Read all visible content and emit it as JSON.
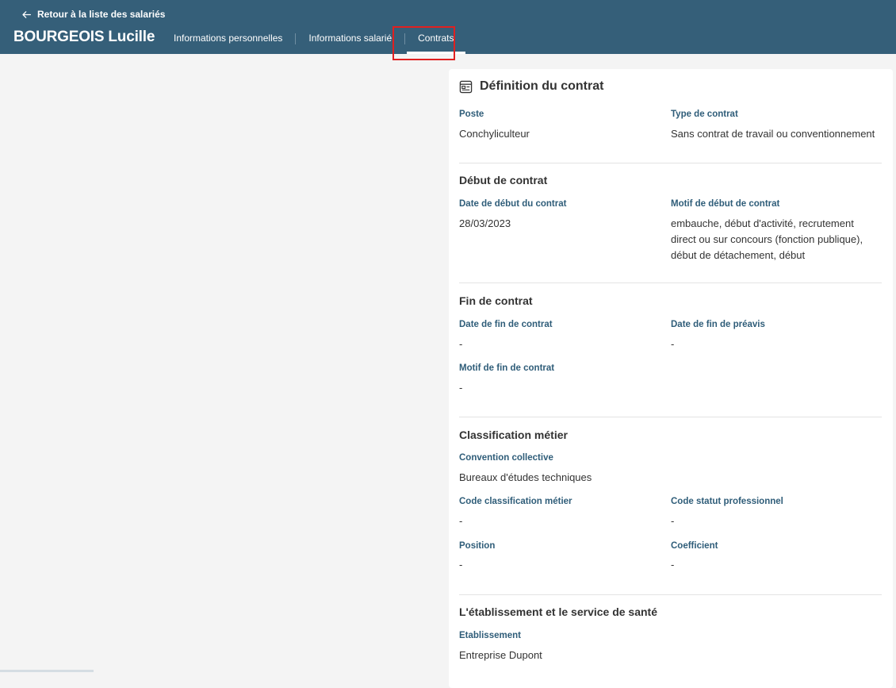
{
  "header": {
    "back_label": "Retour à la liste des salariés",
    "employee_name": "BOURGEOIS Lucille",
    "tabs": [
      {
        "label": "Informations personnelles"
      },
      {
        "label": "Informations salarié"
      },
      {
        "label": "Contrats"
      }
    ],
    "active_tab": "Contrats"
  },
  "colors": {
    "header_bg": "#355f79",
    "label": "#2f5d79",
    "highlight": "#e02020"
  },
  "card": {
    "title": "Définition du contrat",
    "icon": "contract-icon",
    "definition": {
      "poste_label": "Poste",
      "poste_value": "Conchyliculteur",
      "type_label": "Type de contrat",
      "type_value": "Sans contrat de travail ou conventionnement"
    },
    "debut": {
      "title": "Début de contrat",
      "date_label": "Date de début du contrat",
      "date_value": "28/03/2023",
      "motif_label": "Motif de début de contrat",
      "motif_value": "embauche, début d'activité, recrutement direct ou sur concours (fonction publique), début de détachement, début"
    },
    "fin": {
      "title": "Fin de contrat",
      "date_label": "Date de fin de contrat",
      "date_value": "-",
      "preavis_label": "Date de fin de préavis",
      "preavis_value": "-",
      "motif_label": "Motif de fin de contrat",
      "motif_value": "-"
    },
    "classification": {
      "title": "Classification métier",
      "convention_label": "Convention collective",
      "convention_value": "Bureaux d'études techniques",
      "code_classif_label": "Code classification métier",
      "code_classif_value": "-",
      "code_statut_label": "Code statut professionnel",
      "code_statut_value": "-",
      "position_label": "Position",
      "position_value": "-",
      "coefficient_label": "Coefficient",
      "coefficient_value": "-"
    },
    "etablissement": {
      "title": "L'établissement et le service de santé",
      "etab_label": "Etablissement",
      "etab_value": "Entreprise Dupont"
    }
  }
}
